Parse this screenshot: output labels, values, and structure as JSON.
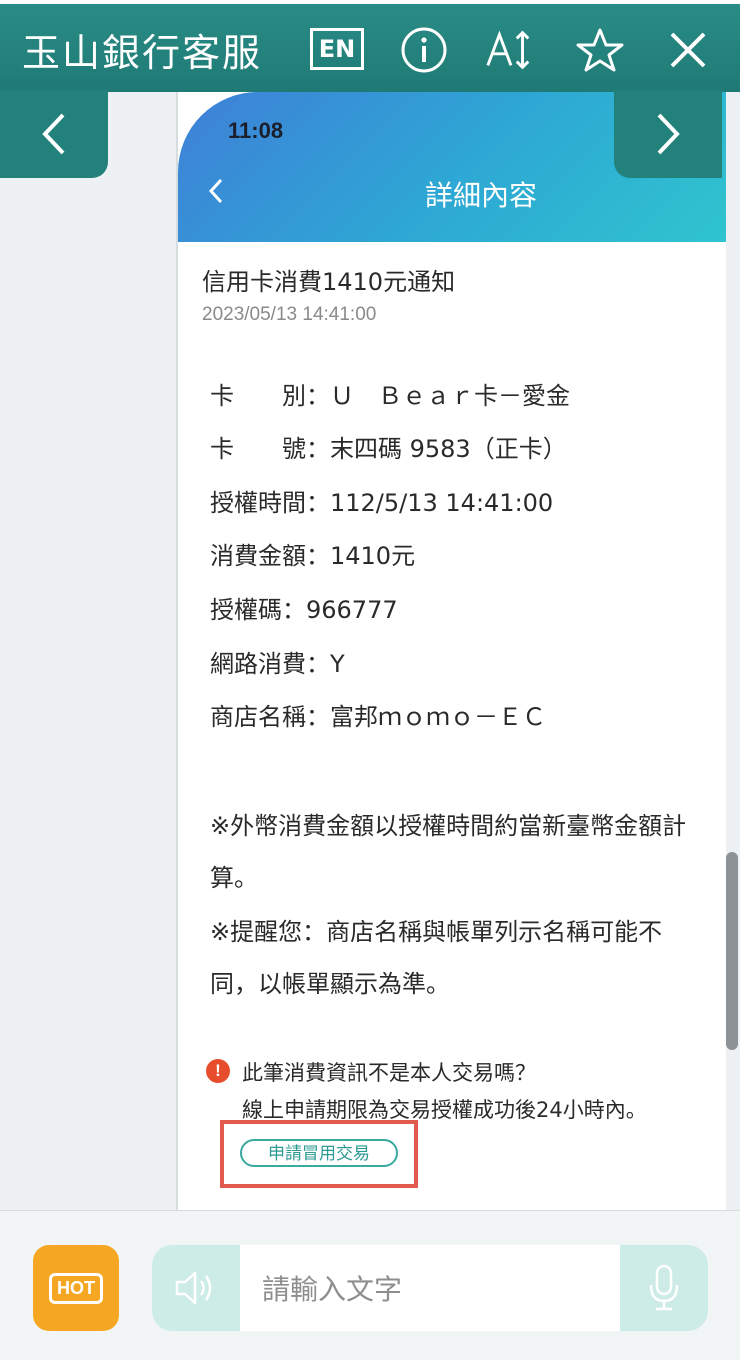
{
  "header": {
    "title": "玉山銀行客服",
    "lang_label": "EN",
    "icons": [
      "info-icon",
      "font-size-icon",
      "star-icon",
      "close-icon"
    ]
  },
  "phone": {
    "time": "11:08",
    "screen_title": "詳細內容"
  },
  "message": {
    "title": "信用卡消費1410元通知",
    "date": "2023/05/13 14:41:00",
    "details": [
      "卡　　別：Ｕ　Ｂｅａｒ卡－愛金",
      "卡　　號：末四碼 9583（正卡）",
      "授權時間：112/5/13 14:41:00",
      "消費金額：1410元",
      "授權碼：966777",
      "網路消費：Y",
      "商店名稱：富邦ｍｏｍｏ－ＥＣ"
    ],
    "notes": [
      "※外幣消費金額以授權時間約當新臺幣金額計",
      "算。",
      "※提醒您：商店名稱與帳單列示名稱可能不",
      "同，以帳單顯示為準。"
    ],
    "warning_line1": "此筆消費資訊不是本人交易嗎？",
    "warning_line2": "線上申請期限為交易授權成功後24小時內。",
    "apply_button": "申請冒用交易"
  },
  "footer": {
    "hot_label": "HOT",
    "input_placeholder": "請輸入文字"
  },
  "colors": {
    "header_bg": "#22817b",
    "hot_bg": "#f5a623",
    "accent": "#3aa9a0",
    "highlight": "#e05a4e"
  }
}
